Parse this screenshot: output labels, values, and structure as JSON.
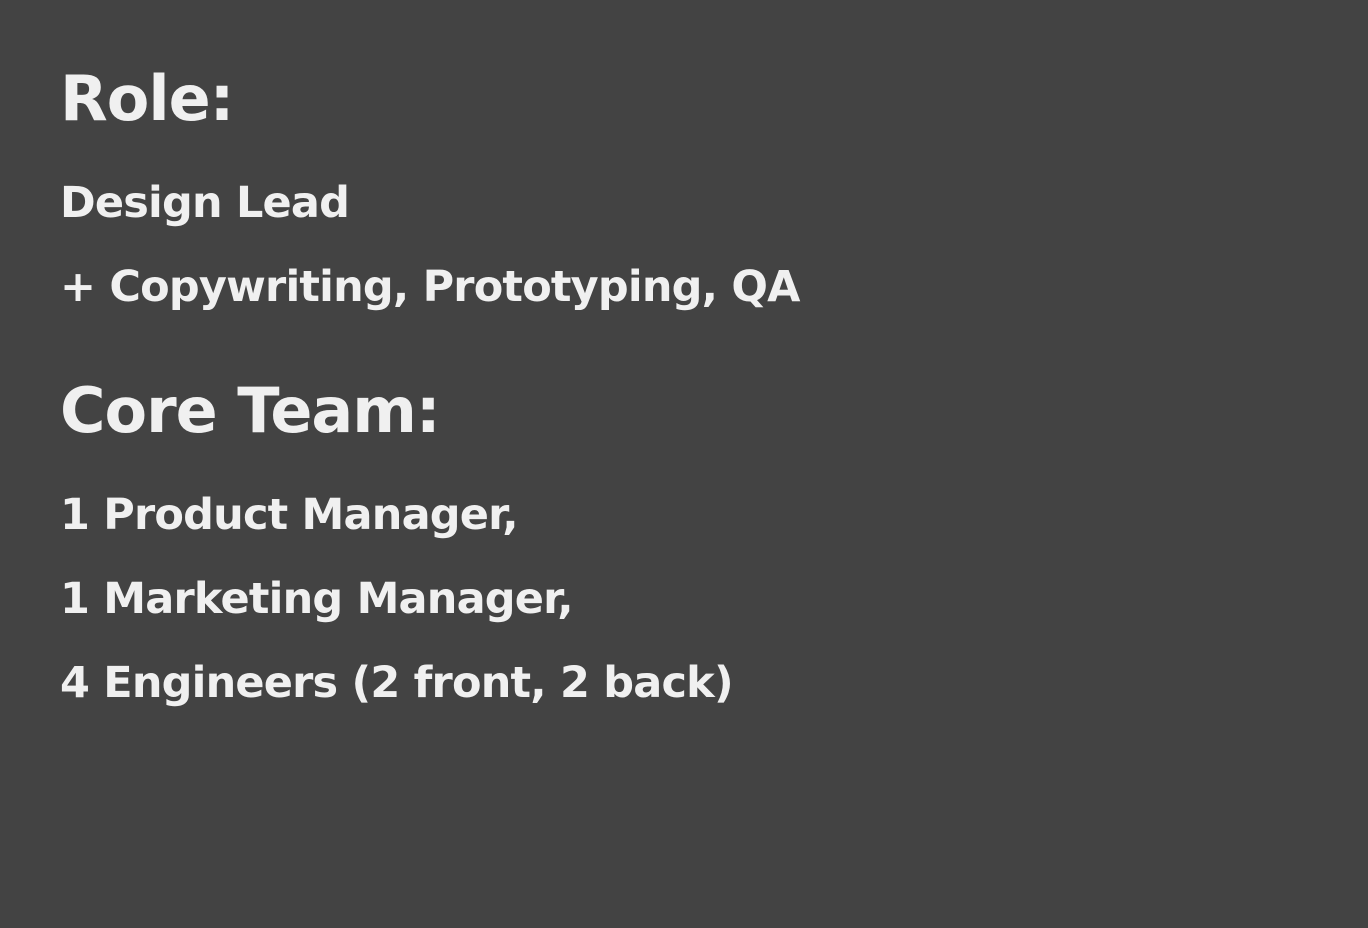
{
  "role": {
    "heading": "Role:",
    "lines": [
      "Design Lead",
      "+ Copywriting, Prototyping, QA"
    ]
  },
  "core_team": {
    "heading": "Core Team:",
    "lines": [
      "1 Product Manager,",
      "1 Marketing Manager,",
      "4 Engineers (2 front, 2 back)"
    ]
  },
  "colors": {
    "background": "#434343",
    "text": "#f0f0f0"
  }
}
